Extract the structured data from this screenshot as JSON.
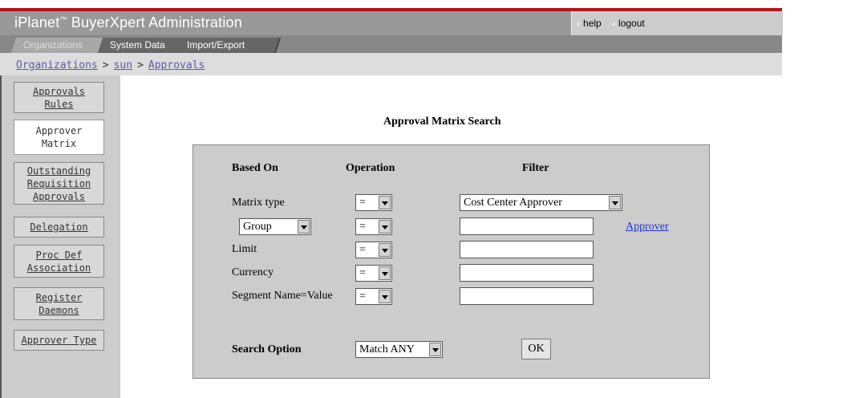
{
  "header": {
    "app_title": "iPlanet",
    "app_tm": "™",
    "app_title_rest": " BuyerXpert Administration",
    "help_label": "help",
    "logout_label": "logout"
  },
  "tabs": [
    {
      "label": "Organizations",
      "active": true
    },
    {
      "label": "System Data",
      "active": false
    },
    {
      "label": "Import/Export",
      "active": false
    }
  ],
  "breadcrumb": {
    "items": [
      "Organizations",
      "sun",
      "Approvals"
    ],
    "separator": ">"
  },
  "sidebar": {
    "items": [
      {
        "label": "Approvals\nRules",
        "active": false
      },
      {
        "label": "Approver\nMatrix",
        "active": true
      },
      {
        "label": "Outstanding\nRequisition\nApprovals",
        "active": false
      },
      {
        "label": "Delegation",
        "active": false
      },
      {
        "label": "Proc Def\nAssociation",
        "active": false
      },
      {
        "label": "Register\nDaemons",
        "active": false
      },
      {
        "label": "Approver Type",
        "active": false
      }
    ]
  },
  "main": {
    "title": "Approval Matrix Search",
    "headers": {
      "based_on": "Based On",
      "operation": "Operation",
      "filter": "Filter"
    },
    "rows": [
      {
        "label": "Matrix type",
        "operation": "=",
        "filter_value": "Cost Center Approver"
      },
      {
        "label_select": "Group",
        "operation": "=",
        "filter_value": ""
      },
      {
        "label": "Limit",
        "operation": "=",
        "filter_value": ""
      },
      {
        "label": "Currency",
        "operation": "=",
        "filter_value": ""
      },
      {
        "label": "Segment Name=Value",
        "operation": "=",
        "filter_value": ""
      }
    ],
    "approver_link": "Approver",
    "search_option_label": "Search Option",
    "search_option_value": "Match ANY",
    "ok_label": "OK"
  },
  "colors": {
    "accent_red": "#b3121c",
    "header_gray": "#999999",
    "tab_gray": "#666666",
    "panel_gray": "#cccccc",
    "link_blue": "#2233cc"
  }
}
